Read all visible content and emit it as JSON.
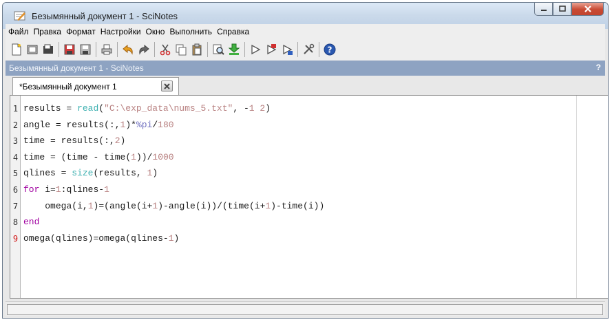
{
  "window": {
    "title": "Безымянный документ 1 - SciNotes",
    "controls": [
      "minimize-icon",
      "maximize-icon",
      "close-icon"
    ]
  },
  "menu": [
    "Файл",
    "Правка",
    "Формат",
    "Настройки",
    "Окно",
    "Выполнить",
    "Справка"
  ],
  "toolbar": {
    "icons": [
      "new-file-icon",
      "open-file-icon",
      "open-folder-icon",
      "save-icon",
      "save-as-icon",
      "print-icon",
      "undo-icon",
      "redo-icon",
      "cut-icon",
      "copy-icon",
      "paste-icon",
      "find-icon",
      "load-into-scilab-icon",
      "execute-icon",
      "execute-file-icon",
      "execute-selection-icon",
      "tools-icon",
      "help-icon"
    ]
  },
  "panel": {
    "title": "Безымянный документ 1 - SciNotes",
    "help": "?"
  },
  "tab": {
    "label": "*Безымянный документ 1"
  },
  "editor": {
    "lines": [
      {
        "n": "1",
        "text": "results = read(\"C:\\exp_data\\nums_5.txt\", -1 2)"
      },
      {
        "n": "2",
        "text": "angle = results(:,1)*%pi/180"
      },
      {
        "n": "3",
        "text": "time = results(:,2)"
      },
      {
        "n": "4",
        "text": "time = (time - time(1))/1000"
      },
      {
        "n": "5",
        "text": "qlines = size(results, 1)"
      },
      {
        "n": "6",
        "text": "for i=1:qlines-1"
      },
      {
        "n": "7",
        "text": "    omega(i,1)=(angle(i+1)-angle(i))/(time(i+1)-time(i))"
      },
      {
        "n": "8",
        "text": "end"
      },
      {
        "n": "9",
        "text": "omega(qlines)=omega(qlines-1)"
      }
    ]
  },
  "colors": {
    "keyword": "#a000a0",
    "function": "#3cb0b0",
    "string": "#b88080",
    "panel_bar": "#8ea3c2",
    "close_button": "#c84a33"
  }
}
